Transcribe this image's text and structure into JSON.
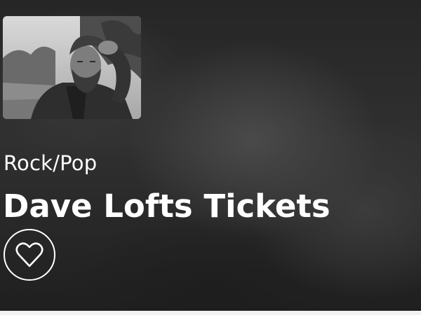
{
  "event": {
    "genre": "Rock/Pop",
    "title": "Dave Lofts Tickets"
  },
  "favorite": {
    "icon": "heart-outline-icon"
  },
  "colors": {
    "text": "#ffffff",
    "background": "#2a2a2a"
  }
}
